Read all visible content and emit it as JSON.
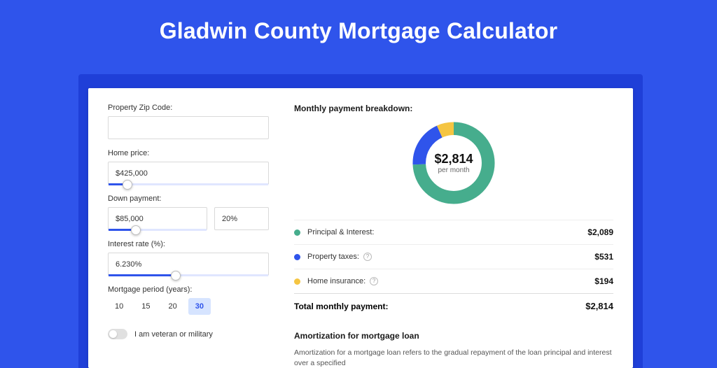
{
  "page_title": "Gladwin County Mortgage Calculator",
  "form": {
    "zip_label": "Property Zip Code:",
    "zip_value": "",
    "home_price_label": "Home price:",
    "home_price_value": "$425,000",
    "home_price_slider_pct": 12,
    "down_payment_label": "Down payment:",
    "down_payment_value": "$85,000",
    "down_payment_pct_value": "20%",
    "down_payment_slider_pct": 28,
    "interest_label": "Interest rate (%):",
    "interest_value": "6.230%",
    "interest_slider_pct": 42,
    "period_label": "Mortgage period (years):",
    "periods": [
      "10",
      "15",
      "20",
      "30"
    ],
    "period_selected": "30",
    "veteran_label": "I am veteran or military"
  },
  "breakdown": {
    "title": "Monthly payment breakdown:",
    "total_amount": "$2,814",
    "per_month_label": "per month",
    "colors": {
      "pi": "#46ad8d",
      "tax": "#2f54eb",
      "ins": "#f5c542"
    },
    "items": [
      {
        "key": "pi",
        "label": "Principal & Interest:",
        "value": "$2,089",
        "has_help": false
      },
      {
        "key": "tax",
        "label": "Property taxes:",
        "value": "$531",
        "has_help": true
      },
      {
        "key": "ins",
        "label": "Home insurance:",
        "value": "$194",
        "has_help": true
      }
    ],
    "total_label": "Total monthly payment:",
    "total_value": "$2,814"
  },
  "chart_data": {
    "type": "pie",
    "title": "Monthly payment breakdown",
    "series": [
      {
        "name": "Principal & Interest",
        "value": 2089,
        "color": "#46ad8d"
      },
      {
        "name": "Property taxes",
        "value": 531,
        "color": "#2f54eb"
      },
      {
        "name": "Home insurance",
        "value": 194,
        "color": "#f5c542"
      }
    ],
    "center_label": "$2,814",
    "center_sublabel": "per month"
  },
  "amort": {
    "heading": "Amortization for mortgage loan",
    "body": "Amortization for a mortgage loan refers to the gradual repayment of the loan principal and interest over a specified"
  }
}
